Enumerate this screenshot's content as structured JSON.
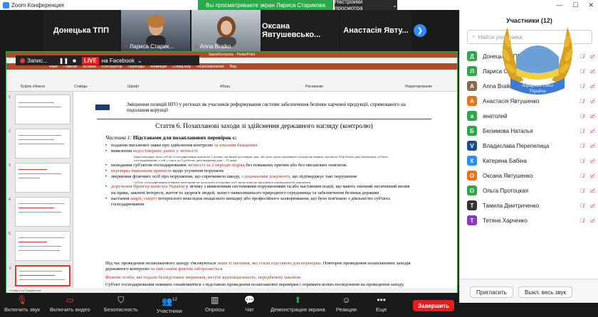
{
  "window": {
    "title": "Zoom Конференция"
  },
  "share_banner": {
    "text": "Вы просматриваете экран Лариса Старикова",
    "view_settings": "Настройки просмотра"
  },
  "tiles": [
    {
      "name": "Донецька ТПП"
    },
    {
      "name": "Лариса Старик...",
      "video": true
    },
    {
      "name": "Anna Braiko",
      "video": true
    },
    {
      "name": "Оксана Явтушевсько..."
    },
    {
      "name": "Анастасія Явту..."
    }
  ],
  "recording": {
    "label": "Запис...",
    "live": "LIVE",
    "platform": "на Facebook"
  },
  "powerpoint": {
    "title": "ЗаконКонтроль - PowerPoint",
    "tabs": [
      "Файл",
      "Главная",
      "Вставка",
      "Конструктор",
      "Переходы",
      "Анимация",
      "Слайд-шоу",
      "Рецензирование",
      "Вид"
    ],
    "groups": [
      "Буфер обмена",
      "Слайды",
      "Шрифт",
      "Абзац",
      "Рисование",
      "Редактирование"
    ],
    "status": "Слайд 5 из 9   українська"
  },
  "slide": {
    "header": "Зміцнення позицій НГО у регіонах як учасників реформування системи забезпечення безпеки харчової продукції, спрямованого на подолання корупції",
    "article_title": "Стаття 6. Позапланові заходи зі здійснення державного нагляду (контролю)",
    "part_label": "Частина 1:",
    "part_text": "Підставами для позапланових перевірок є:",
    "items": [
      {
        "text": "подання письмової заяви про здійснення контролю ",
        "red": "за власним бажанням"
      },
      {
        "text": "виявлення ",
        "red": "недостовірних даних у звітності"
      },
      {
        "note": "(крім випадків, коли суб'єкт господарювання протягом 1 місяця сам надав достовірні дані, або коли орган державного контролю виявив, протягом 10 робочих днів повідомив суб'єкта господарювання, а той у строк до 5 робочих днів виправив дані – 15 днів)"
      },
      {
        "text": "неподання суб'єктом господарювання ",
        "red": "звітності за 2 періоди підряд",
        "tail": " без поважних причин або без письмових пояснень"
      },
      {
        "red": "перевірка виконання приписів",
        "tail": " щодо усунення порушень"
      },
      {
        "text": "звернення фізичних осіб про порушення, що спричинило шкоду, ",
        "red": "з додаванням документу",
        "tail": ", що підтверджує такі порушення"
      },
      {
        "note": "суб'єкт господарювання повинен мати право не допускати посадових осіб, якщо вони не пред'явили підтверджуючі документи"
      },
      {
        "red": "доручення Прем'єр-міністра України",
        "tail": " у зв'язку з виявленими системними порушеннями та/або настанням подій, що мають значний негативний вплив на права, законні інтереси, життя та здоров'я людей, захист навколишнього природного середовища та забезпечення безпеки держави"
      },
      {
        "text": "настання ",
        "red": "аварії, смерті",
        "tail": " потерпілого внаслідок нещасного випадку або професійного захворювання, що було пов'язано з діяльністю суб'єкта господарювання"
      }
    ],
    "para1_a": "Під час проведення позапланового заходу з'ясовуються ",
    "para1_red": "лише ті питання, які стали підставою для перевірки",
    "para1_b": ". Повторне проведення позапланових заходів державного контролю ",
    "para1_red2": "за тим самим фактом забороняється",
    "para2_red": "Фізичні особи, які подали безпідставне звернення, несуть відповідальність, передбачену законом.",
    "para3": "Суб'єкт господарювання повинен ознайомитися з підставою проведення позапланової перевірки і отримати копію посвідчення на проведення заходу."
  },
  "panel": {
    "title": "Участники (12)",
    "search_placeholder": "Найти участника",
    "participants": [
      {
        "initial": "Д",
        "name": "Донецька ТПП",
        "color": "#2ba84a"
      },
      {
        "initial": "Л",
        "name": "Лариса Старикова",
        "color": "#2ba84a"
      },
      {
        "initial": "A",
        "name": "Anna Braiko",
        "color": "#8a6a4a"
      },
      {
        "initial": "А",
        "name": "Анастасія Явтушенко",
        "color": "#e8741a"
      },
      {
        "initial": "а",
        "name": "анатолий",
        "color": "#2ba84a"
      },
      {
        "initial": "Б",
        "name": "Белимова Наталья",
        "color": "#2ba84a"
      },
      {
        "initial": "V",
        "name": "Владислава Перепелица",
        "color": "#1f4e8c"
      },
      {
        "initial": "К",
        "name": "Катерина Бабіна",
        "color": "#2d8cff"
      },
      {
        "initial": "О",
        "name": "Оксана Явтушенко",
        "color": "#e8741a"
      },
      {
        "initial": "О",
        "name": "Ольга Протоцкая",
        "color": "#2ba84a"
      },
      {
        "initial": "Т",
        "name": "Тамила Дмитриченко",
        "color": "#333333"
      },
      {
        "initial": "Т",
        "name": "Тетяна Харченко",
        "color": "#8a3ab9"
      }
    ],
    "invite": "Пригласить",
    "mute_all": "Выкл. весь звук",
    "emblem_text": "Аграрний союз України"
  },
  "toolbar": {
    "mute": "Включить звук",
    "video": "Включить видео",
    "security": "Безопасность",
    "participants": "Участники",
    "participants_count": "12",
    "polls": "Опросы",
    "chat": "Чат",
    "share": "Демонстрация экрана",
    "reactions": "Реакции",
    "more": "Еще",
    "end": "Завершить"
  }
}
